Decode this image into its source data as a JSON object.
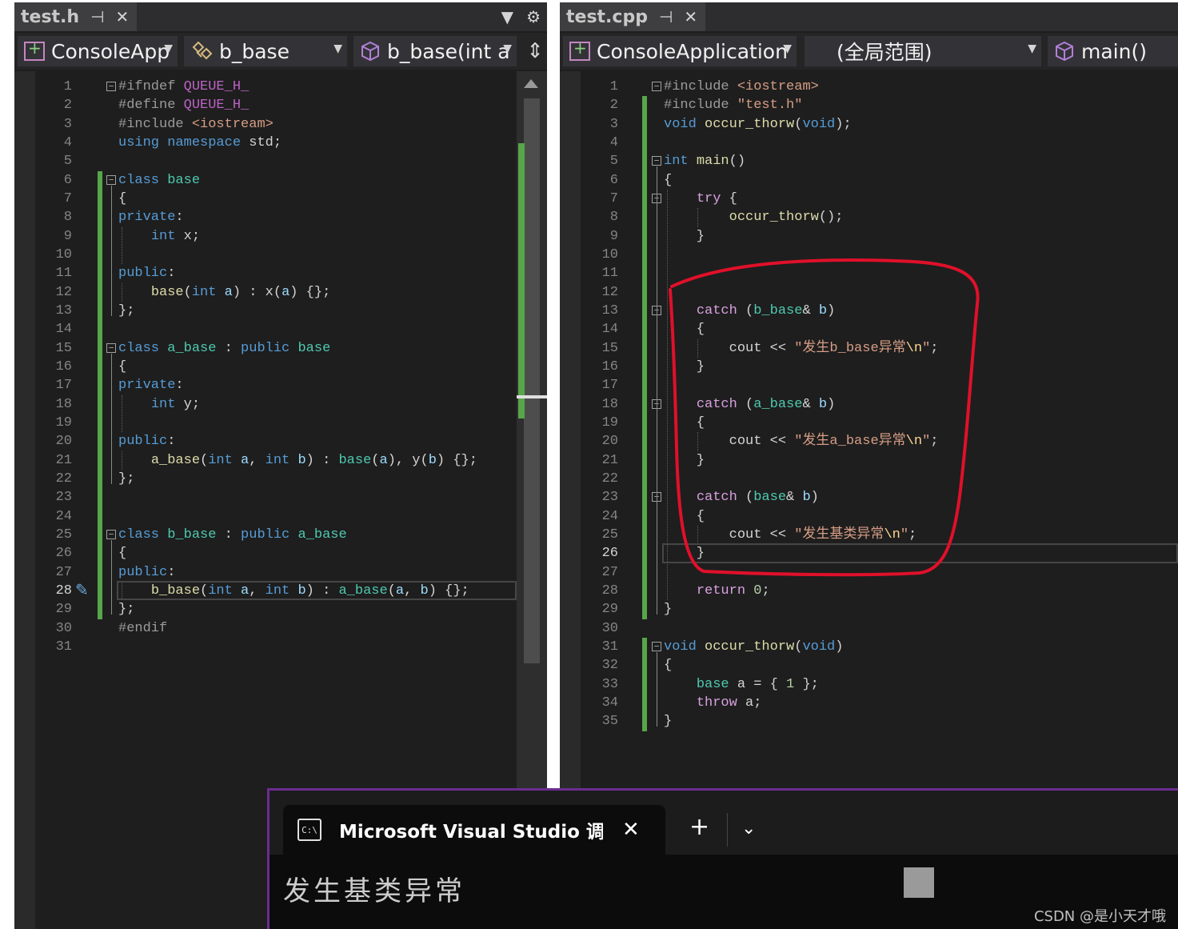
{
  "left_pane": {
    "tab_title": "test.h",
    "pin_icon": "pin-icon",
    "close_icon": "close-icon",
    "nav": {
      "project": "ConsoleApp",
      "scope": "b_base",
      "member": "b_base(int a"
    },
    "current_line": 28,
    "lines": [
      {
        "n": 1,
        "html": "<span class='pp'>#ifndef</span> <span class='mc'>QUEUE_H_</span>"
      },
      {
        "n": 2,
        "html": "<span class='pp'>#define</span> <span class='mc'>QUEUE_H_</span>"
      },
      {
        "n": 3,
        "html": "<span class='pp'>#include</span> <span class='st'>&lt;iostream&gt;</span>"
      },
      {
        "n": 4,
        "html": "<span class='kw'>using</span> <span class='kw'>namespace</span> std;"
      },
      {
        "n": 5,
        "html": ""
      },
      {
        "n": 6,
        "html": "<span class='kw'>class</span> <span class='tp'>base</span>"
      },
      {
        "n": 7,
        "html": "{"
      },
      {
        "n": 8,
        "html": "<span class='kw'>private</span>:"
      },
      {
        "n": 9,
        "html": "    <span class='kw'>int</span> x;"
      },
      {
        "n": 10,
        "html": ""
      },
      {
        "n": 11,
        "html": "<span class='kw'>public</span>:"
      },
      {
        "n": 12,
        "html": "    <span class='fn'>base</span>(<span class='kw'>int</span> <span class='pm'>a</span>) : x(<span class='pm'>a</span>) {};"
      },
      {
        "n": 13,
        "html": "};"
      },
      {
        "n": 14,
        "html": ""
      },
      {
        "n": 15,
        "html": "<span class='kw'>class</span> <span class='tp'>a_base</span> : <span class='kw'>public</span> <span class='tp'>base</span>"
      },
      {
        "n": 16,
        "html": "{"
      },
      {
        "n": 17,
        "html": "<span class='kw'>private</span>:"
      },
      {
        "n": 18,
        "html": "    <span class='kw'>int</span> y;"
      },
      {
        "n": 19,
        "html": ""
      },
      {
        "n": 20,
        "html": "<span class='kw'>public</span>:"
      },
      {
        "n": 21,
        "html": "    <span class='fn'>a_base</span>(<span class='kw'>int</span> <span class='pm'>a</span>, <span class='kw'>int</span> <span class='pm'>b</span>) : <span class='tp'>base</span>(<span class='pm'>a</span>), y(<span class='pm'>b</span>) {};"
      },
      {
        "n": 22,
        "html": "};"
      },
      {
        "n": 23,
        "html": ""
      },
      {
        "n": 24,
        "html": ""
      },
      {
        "n": 25,
        "html": "<span class='kw'>class</span> <span class='tp'>b_base</span> : <span class='kw'>public</span> <span class='tp'>a_base</span>"
      },
      {
        "n": 26,
        "html": "{"
      },
      {
        "n": 27,
        "html": "<span class='kw'>public</span>:"
      },
      {
        "n": 28,
        "html": "    <span class='fn'>b_base</span>(<span class='kw'>int</span> <span class='pm'>a</span>, <span class='kw'>int</span> <span class='pm'>b</span>) : <span class='tp'>a_base</span>(<span class='pm'>a</span>, <span class='pm'>b</span>) {};"
      },
      {
        "n": 29,
        "html": "};"
      },
      {
        "n": 30,
        "html": "<span class='pp'>#endif</span>"
      },
      {
        "n": 31,
        "html": ""
      }
    ]
  },
  "right_pane": {
    "tab_title": "test.cpp",
    "pin_icon": "pin-icon",
    "close_icon": "close-icon",
    "nav": {
      "project": "ConsoleApplication",
      "scope": "(全局范围)",
      "member": "main()"
    },
    "current_line": 26,
    "lines": [
      {
        "n": 1,
        "html": "<span class='pp'>#include</span> <span class='st'>&lt;iostream&gt;</span>"
      },
      {
        "n": 2,
        "html": "<span class='pp'>#include</span> <span class='st'>\"test.h\"</span>"
      },
      {
        "n": 3,
        "html": "<span class='kw'>void</span> <span class='fn'>occur_thorw</span>(<span class='kw'>void</span>);"
      },
      {
        "n": 4,
        "html": ""
      },
      {
        "n": 5,
        "html": "<span class='kw'>int</span> <span class='fn'>main</span>()"
      },
      {
        "n": 6,
        "html": "{"
      },
      {
        "n": 7,
        "html": "    <span class='cf'>try</span> {"
      },
      {
        "n": 8,
        "html": "        <span class='fn'>occur_thorw</span>();"
      },
      {
        "n": 9,
        "html": "    }"
      },
      {
        "n": 10,
        "html": ""
      },
      {
        "n": 11,
        "html": ""
      },
      {
        "n": 12,
        "html": ""
      },
      {
        "n": 13,
        "html": "    <span class='cf'>catch</span> (<span class='tp'>b_base</span>&amp; <span class='pm'>b</span>)"
      },
      {
        "n": 14,
        "html": "    {"
      },
      {
        "n": 15,
        "html": "        cout &lt;&lt; <span class='st'>\"发生b_base异常</span><span class='es'>\\n</span><span class='st'>\"</span>;"
      },
      {
        "n": 16,
        "html": "    }"
      },
      {
        "n": 17,
        "html": ""
      },
      {
        "n": 18,
        "html": "    <span class='cf'>catch</span> (<span class='tp'>a_base</span>&amp; <span class='pm'>b</span>)"
      },
      {
        "n": 19,
        "html": "    {"
      },
      {
        "n": 20,
        "html": "        cout &lt;&lt; <span class='st'>\"发生a_base异常</span><span class='es'>\\n</span><span class='st'>\"</span>;"
      },
      {
        "n": 21,
        "html": "    }"
      },
      {
        "n": 22,
        "html": ""
      },
      {
        "n": 23,
        "html": "    <span class='cf'>catch</span> (<span class='tp'>base</span>&amp; <span class='pm'>b</span>)"
      },
      {
        "n": 24,
        "html": "    {"
      },
      {
        "n": 25,
        "html": "        cout &lt;&lt; <span class='st'>\"发生基类异常</span><span class='es'>\\n</span><span class='st'>\"</span>;"
      },
      {
        "n": 26,
        "html": "    }"
      },
      {
        "n": 27,
        "html": ""
      },
      {
        "n": 28,
        "html": "    <span class='cf'>return</span> <span class='nu'>0</span>;"
      },
      {
        "n": 29,
        "html": "}"
      },
      {
        "n": 30,
        "html": ""
      },
      {
        "n": 31,
        "html": "<span class='kw'>void</span> <span class='fn'>occur_thorw</span>(<span class='kw'>void</span>)"
      },
      {
        "n": 32,
        "html": "{"
      },
      {
        "n": 33,
        "html": "    <span class='tp'>base</span> a = { <span class='nu'>1</span> };"
      },
      {
        "n": 34,
        "html": "    <span class='cf'>throw</span> a;"
      },
      {
        "n": 35,
        "html": "}"
      }
    ]
  },
  "terminal": {
    "tab_title": "Microsoft Visual Studio 调试控制台",
    "cmd_icon_label": "C:\\",
    "close_glyph": "✕",
    "new_tab_glyph": "+",
    "dropdown_glyph": "⌄",
    "output": "发生基类异常"
  },
  "watermark": "CSDN @是小天才哦",
  "icons": [
    "pin-icon",
    "close-icon",
    "dropdown-arrow-icon",
    "settings-gear-icon",
    "project-icon",
    "class-icon",
    "method-cube-icon",
    "split-editor-icon",
    "scroll-up-icon",
    "screwdriver-icon",
    "terminal-cmd-icon"
  ],
  "colors": {
    "editor_bg": "#1e1e1e",
    "change_bar": "#57a64a",
    "annotation_red": "#e0102a",
    "terminal_border": "#6b2c91"
  }
}
